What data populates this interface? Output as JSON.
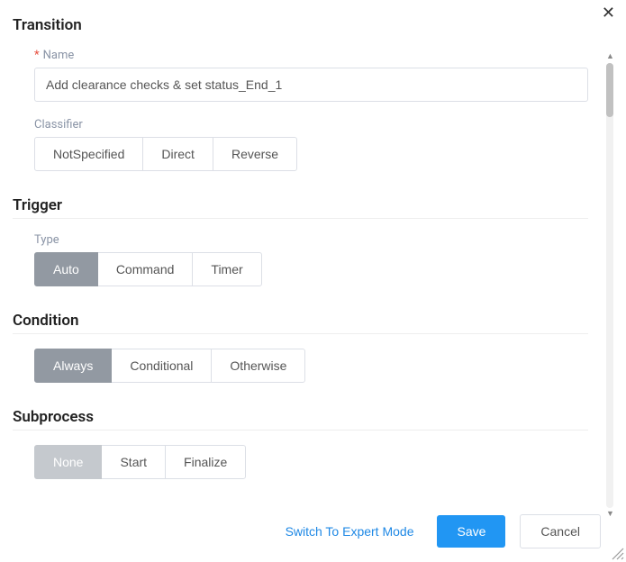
{
  "close_label": "✕",
  "transition": {
    "title": "Transition",
    "name_label": "Name",
    "name_value": "Add clearance checks & set status_End_1",
    "classifier_label": "Classifier",
    "classifier_options": [
      "NotSpecified",
      "Direct",
      "Reverse"
    ],
    "classifier_selected": null
  },
  "trigger": {
    "title": "Trigger",
    "type_label": "Type",
    "options": [
      "Auto",
      "Command",
      "Timer"
    ],
    "selected": "Auto"
  },
  "condition": {
    "title": "Condition",
    "options": [
      "Always",
      "Conditional",
      "Otherwise"
    ],
    "selected": "Always"
  },
  "subprocess": {
    "title": "Subprocess",
    "options": [
      "None",
      "Start",
      "Finalize"
    ],
    "selected": "None"
  },
  "footer": {
    "expert_mode": "Switch To Expert Mode",
    "save": "Save",
    "cancel": "Cancel"
  }
}
